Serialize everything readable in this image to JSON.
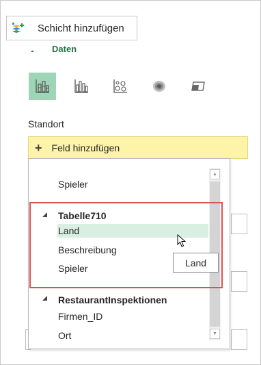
{
  "toolbar": {
    "add_layer_label": "Schicht hinzufügen"
  },
  "section": {
    "daten_label": "Daten"
  },
  "viz_types": [
    {
      "icon": "stacked-column-chart-icon",
      "active": true
    },
    {
      "icon": "clustered-column-chart-icon",
      "active": false
    },
    {
      "icon": "bubble-chart-icon",
      "active": false
    },
    {
      "icon": "heat-map-icon",
      "active": false
    },
    {
      "icon": "region-map-icon",
      "active": false
    }
  ],
  "location": {
    "label": "Standort",
    "add_field_label": "Feld hinzufügen"
  },
  "dropdown": {
    "top_item": "Spieler",
    "groups": [
      {
        "name": "Tabelle710",
        "items": [
          "Land",
          "Beschreibung",
          "Spieler"
        ]
      },
      {
        "name": "RestaurantInspektionen",
        "items": [
          "Firmen_ID",
          "Ort"
        ]
      }
    ],
    "hovered_item": "Land"
  },
  "tooltip": {
    "text": "Land"
  },
  "colors": {
    "accent": "#217346",
    "highlight": "#d9efe2",
    "focus": "#e05050",
    "field_bar": "#fdf3a9"
  }
}
